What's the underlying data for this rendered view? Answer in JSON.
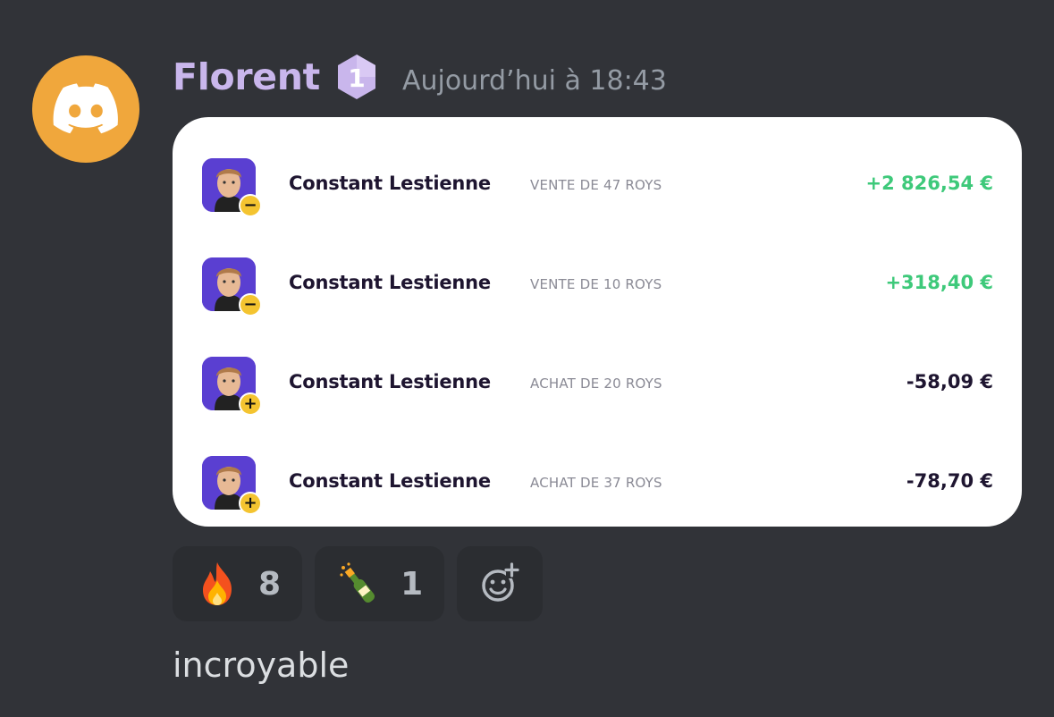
{
  "message": {
    "author": "Florent",
    "badge_label": "1",
    "timestamp": "Aujourd’hui à 18:43",
    "text": "incroyable"
  },
  "transactions": [
    {
      "player": "Constant Lestienne",
      "description": "VENTE DE 47 ROYS",
      "amount": "+2 826,54 €",
      "type": "sell",
      "sign": "−"
    },
    {
      "player": "Constant Lestienne",
      "description": "VENTE DE 10 ROYS",
      "amount": "+318,40 €",
      "type": "sell",
      "sign": "−"
    },
    {
      "player": "Constant Lestienne",
      "description": "ACHAT DE 20 ROYS",
      "amount": "-58,09 €",
      "type": "buy",
      "sign": "+"
    },
    {
      "player": "Constant Lestienne",
      "description": "ACHAT DE 37 ROYS",
      "amount": "-78,70 €",
      "type": "buy",
      "sign": "+"
    }
  ],
  "reactions": [
    {
      "icon": "fire-emoji",
      "count": "8"
    },
    {
      "icon": "champagne-emoji",
      "count": "1"
    }
  ],
  "icons": {
    "avatar": "discord-logo-icon",
    "add_reaction": "add-reaction-icon"
  },
  "colors": {
    "background": "#313338",
    "username": "#c9b6ec",
    "avatar_bg": "#f0a73c",
    "positive": "#3ec97a",
    "player_bg": "#5a3fd1",
    "badge": "#f4c430"
  }
}
